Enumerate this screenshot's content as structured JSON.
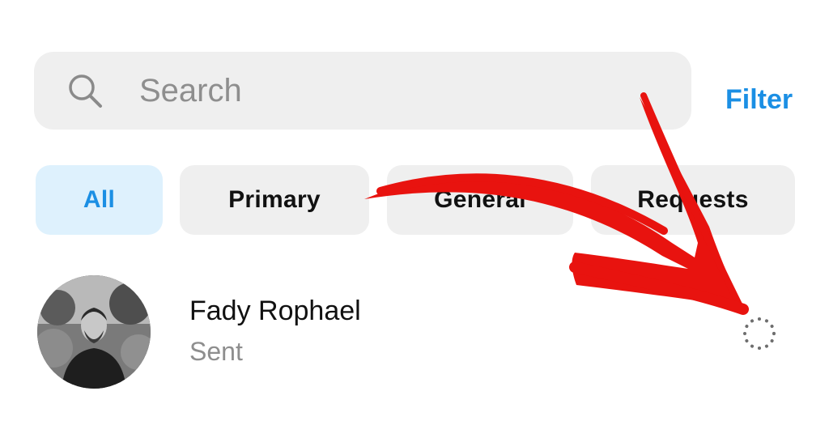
{
  "search": {
    "placeholder": "Search"
  },
  "header": {
    "filter_label": "Filter"
  },
  "tabs": [
    {
      "label": "All",
      "active": true
    },
    {
      "label": "Primary",
      "active": false
    },
    {
      "label": "General",
      "active": false
    },
    {
      "label": "Requests",
      "active": false
    }
  ],
  "conversations": [
    {
      "name": "Fady Rophael",
      "status": "Sent",
      "status_icon": "dotted-circle-icon"
    }
  ],
  "colors": {
    "accent": "#1b8fe4",
    "active_tab_bg": "#def1fd",
    "chip_bg": "#efefef",
    "annotation": "#e8130f"
  }
}
